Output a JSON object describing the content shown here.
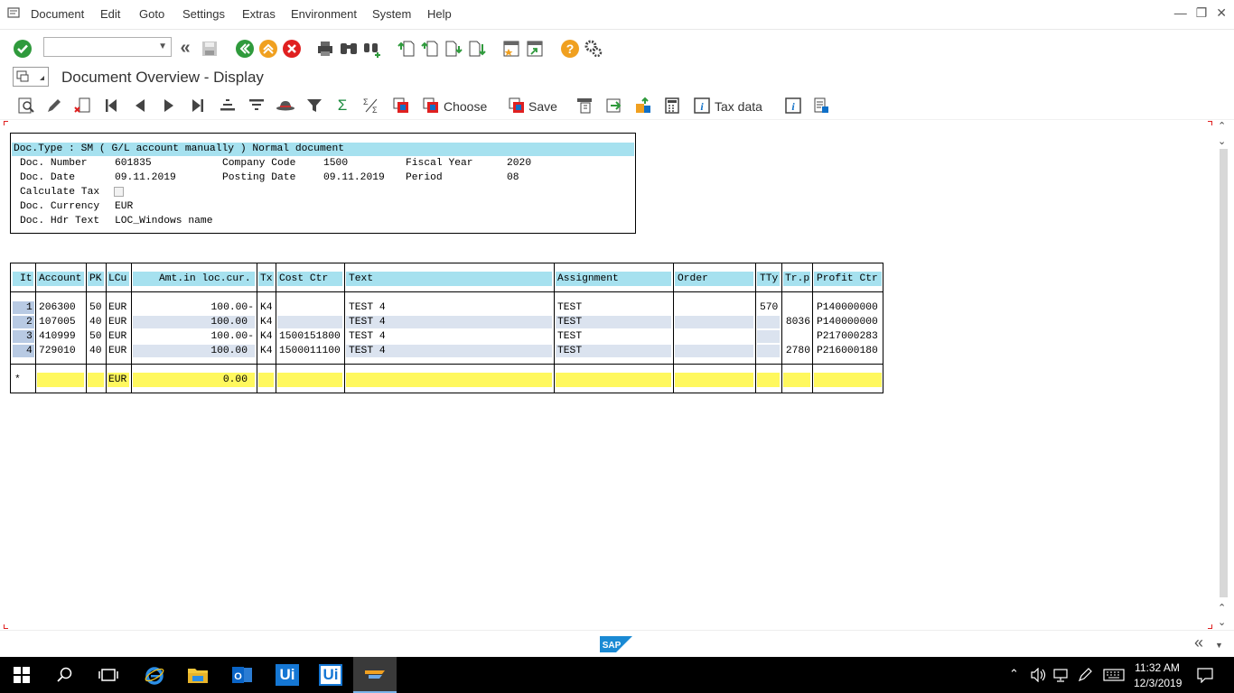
{
  "menubar": {
    "items": [
      "Document",
      "Edit",
      "Goto",
      "Settings",
      "Extras",
      "Environment",
      "System",
      "Help"
    ]
  },
  "title": "Document Overview - Display",
  "toolbar2": {
    "choose_label": "Choose",
    "save_label": "Save",
    "taxdata_label": "Tax data"
  },
  "header": {
    "doc_type_line": "Doc.Type : SM ( G/L account manually ) Normal document",
    "doc_number_label": "Doc. Number",
    "doc_number": "601835",
    "company_code_label": "Company Code",
    "company_code": "1500",
    "fiscal_year_label": "Fiscal Year",
    "fiscal_year": "2020",
    "doc_date_label": "Doc. Date",
    "doc_date": "09.11.2019",
    "posting_date_label": "Posting Date",
    "posting_date": "09.11.2019",
    "period_label": "Period",
    "period": "08",
    "calc_tax_label": "Calculate Tax",
    "currency_label": "Doc. Currency",
    "currency": "EUR",
    "hdr_text_label": "Doc. Hdr Text",
    "hdr_text": "LOC_Windows name"
  },
  "table": {
    "columns": [
      "It",
      "Account",
      "PK",
      "LCu",
      "Amt.in loc.cur.",
      "Tx",
      "Cost Ctr",
      "Text",
      "Assignment",
      "Order",
      "TTy",
      "Tr.p",
      "Profit Ctr"
    ],
    "rows": [
      {
        "it": "1",
        "account": "206300",
        "pk": "50",
        "lcu": "EUR",
        "amt": "100.00-",
        "tx": "K4",
        "cost": "",
        "text": "TEST 4",
        "assign": "TEST",
        "order": "",
        "tty": "570",
        "trp": "",
        "profit": "P140000000"
      },
      {
        "it": "2",
        "account": "107005",
        "pk": "40",
        "lcu": "EUR",
        "amt": "100.00",
        "tx": "K4",
        "cost": "",
        "text": "TEST 4",
        "assign": "TEST",
        "order": "",
        "tty": "",
        "trp": "8036",
        "profit": "P140000000"
      },
      {
        "it": "3",
        "account": "410999",
        "pk": "50",
        "lcu": "EUR",
        "amt": "100.00-",
        "tx": "K4",
        "cost": "1500151800",
        "text": "TEST 4",
        "assign": "TEST",
        "order": "",
        "tty": "",
        "trp": "",
        "profit": "P217000283"
      },
      {
        "it": "4",
        "account": "729010",
        "pk": "40",
        "lcu": "EUR",
        "amt": "100.00",
        "tx": "K4",
        "cost": "1500011100",
        "text": "TEST 4",
        "assign": "TEST",
        "order": "",
        "tty": "",
        "trp": "2780",
        "profit": "P216000180"
      }
    ],
    "total": {
      "marker": "*",
      "lcu": "EUR",
      "amt": "0.00"
    }
  },
  "status": {
    "logo": "SAP"
  },
  "taskbar": {
    "time": "11:32 AM",
    "date": "12/3/2019",
    "ui1": "Ui",
    "ui2": "Ui"
  },
  "colors": {
    "header_blue": "#a6e1ef",
    "total_yellow": "#fff85e",
    "sap_blue": "#1070c8"
  }
}
